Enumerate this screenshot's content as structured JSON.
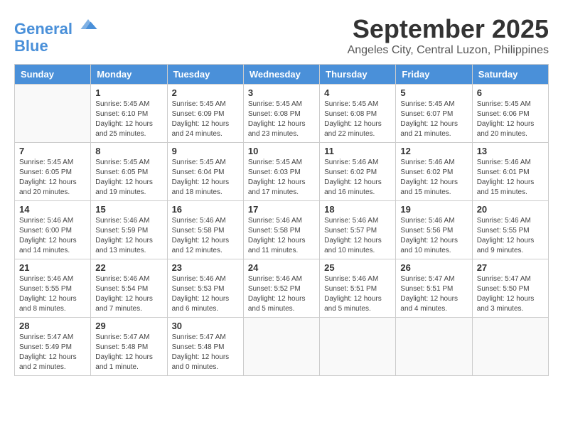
{
  "logo": {
    "line1": "General",
    "line2": "Blue"
  },
  "title": "September 2025",
  "location": "Angeles City, Central Luzon, Philippines",
  "headers": [
    "Sunday",
    "Monday",
    "Tuesday",
    "Wednesday",
    "Thursday",
    "Friday",
    "Saturday"
  ],
  "weeks": [
    [
      {
        "day": "",
        "info": ""
      },
      {
        "day": "1",
        "info": "Sunrise: 5:45 AM\nSunset: 6:10 PM\nDaylight: 12 hours\nand 25 minutes."
      },
      {
        "day": "2",
        "info": "Sunrise: 5:45 AM\nSunset: 6:09 PM\nDaylight: 12 hours\nand 24 minutes."
      },
      {
        "day": "3",
        "info": "Sunrise: 5:45 AM\nSunset: 6:08 PM\nDaylight: 12 hours\nand 23 minutes."
      },
      {
        "day": "4",
        "info": "Sunrise: 5:45 AM\nSunset: 6:08 PM\nDaylight: 12 hours\nand 22 minutes."
      },
      {
        "day": "5",
        "info": "Sunrise: 5:45 AM\nSunset: 6:07 PM\nDaylight: 12 hours\nand 21 minutes."
      },
      {
        "day": "6",
        "info": "Sunrise: 5:45 AM\nSunset: 6:06 PM\nDaylight: 12 hours\nand 20 minutes."
      }
    ],
    [
      {
        "day": "7",
        "info": "Sunrise: 5:45 AM\nSunset: 6:05 PM\nDaylight: 12 hours\nand 20 minutes."
      },
      {
        "day": "8",
        "info": "Sunrise: 5:45 AM\nSunset: 6:05 PM\nDaylight: 12 hours\nand 19 minutes."
      },
      {
        "day": "9",
        "info": "Sunrise: 5:45 AM\nSunset: 6:04 PM\nDaylight: 12 hours\nand 18 minutes."
      },
      {
        "day": "10",
        "info": "Sunrise: 5:45 AM\nSunset: 6:03 PM\nDaylight: 12 hours\nand 17 minutes."
      },
      {
        "day": "11",
        "info": "Sunrise: 5:46 AM\nSunset: 6:02 PM\nDaylight: 12 hours\nand 16 minutes."
      },
      {
        "day": "12",
        "info": "Sunrise: 5:46 AM\nSunset: 6:02 PM\nDaylight: 12 hours\nand 15 minutes."
      },
      {
        "day": "13",
        "info": "Sunrise: 5:46 AM\nSunset: 6:01 PM\nDaylight: 12 hours\nand 15 minutes."
      }
    ],
    [
      {
        "day": "14",
        "info": "Sunrise: 5:46 AM\nSunset: 6:00 PM\nDaylight: 12 hours\nand 14 minutes."
      },
      {
        "day": "15",
        "info": "Sunrise: 5:46 AM\nSunset: 5:59 PM\nDaylight: 12 hours\nand 13 minutes."
      },
      {
        "day": "16",
        "info": "Sunrise: 5:46 AM\nSunset: 5:58 PM\nDaylight: 12 hours\nand 12 minutes."
      },
      {
        "day": "17",
        "info": "Sunrise: 5:46 AM\nSunset: 5:58 PM\nDaylight: 12 hours\nand 11 minutes."
      },
      {
        "day": "18",
        "info": "Sunrise: 5:46 AM\nSunset: 5:57 PM\nDaylight: 12 hours\nand 10 minutes."
      },
      {
        "day": "19",
        "info": "Sunrise: 5:46 AM\nSunset: 5:56 PM\nDaylight: 12 hours\nand 10 minutes."
      },
      {
        "day": "20",
        "info": "Sunrise: 5:46 AM\nSunset: 5:55 PM\nDaylight: 12 hours\nand 9 minutes."
      }
    ],
    [
      {
        "day": "21",
        "info": "Sunrise: 5:46 AM\nSunset: 5:55 PM\nDaylight: 12 hours\nand 8 minutes."
      },
      {
        "day": "22",
        "info": "Sunrise: 5:46 AM\nSunset: 5:54 PM\nDaylight: 12 hours\nand 7 minutes."
      },
      {
        "day": "23",
        "info": "Sunrise: 5:46 AM\nSunset: 5:53 PM\nDaylight: 12 hours\nand 6 minutes."
      },
      {
        "day": "24",
        "info": "Sunrise: 5:46 AM\nSunset: 5:52 PM\nDaylight: 12 hours\nand 5 minutes."
      },
      {
        "day": "25",
        "info": "Sunrise: 5:46 AM\nSunset: 5:51 PM\nDaylight: 12 hours\nand 5 minutes."
      },
      {
        "day": "26",
        "info": "Sunrise: 5:47 AM\nSunset: 5:51 PM\nDaylight: 12 hours\nand 4 minutes."
      },
      {
        "day": "27",
        "info": "Sunrise: 5:47 AM\nSunset: 5:50 PM\nDaylight: 12 hours\nand 3 minutes."
      }
    ],
    [
      {
        "day": "28",
        "info": "Sunrise: 5:47 AM\nSunset: 5:49 PM\nDaylight: 12 hours\nand 2 minutes."
      },
      {
        "day": "29",
        "info": "Sunrise: 5:47 AM\nSunset: 5:48 PM\nDaylight: 12 hours\nand 1 minute."
      },
      {
        "day": "30",
        "info": "Sunrise: 5:47 AM\nSunset: 5:48 PM\nDaylight: 12 hours\nand 0 minutes."
      },
      {
        "day": "",
        "info": ""
      },
      {
        "day": "",
        "info": ""
      },
      {
        "day": "",
        "info": ""
      },
      {
        "day": "",
        "info": ""
      }
    ]
  ]
}
